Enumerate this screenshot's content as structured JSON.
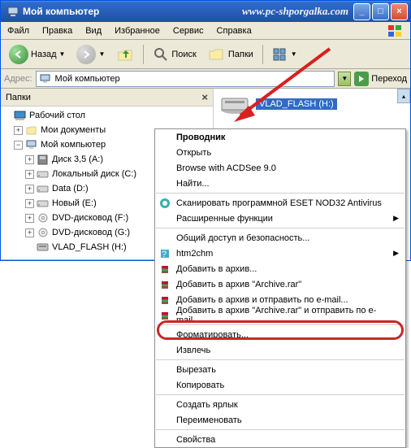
{
  "titlebar": {
    "title": "Мой компьютер",
    "watermark": "www.pc-shporgalka.com"
  },
  "menubar": {
    "file": "Файл",
    "edit": "Правка",
    "view": "Вид",
    "favorites": "Избранное",
    "service": "Сервис",
    "help": "Справка"
  },
  "toolbar": {
    "back": "Назад",
    "search": "Поиск",
    "folders": "Папки"
  },
  "addressbar": {
    "label": "Адрес:",
    "value": "Мой компьютер",
    "go": "Переход"
  },
  "sidebar": {
    "header": "Папки",
    "desktop": "Рабочий стол",
    "docs": "Мои документы",
    "computer": "Мой компьютер",
    "drives": {
      "floppy": "Диск 3,5 (A:)",
      "local": "Локальный диск (C:)",
      "data": "Data (D:)",
      "new": "Новый (E:)",
      "dvd1": "DVD-дисковод (F:)",
      "dvd2": "DVD-дисковод (G:)",
      "flash": "VLAD_FLASH (H:)"
    }
  },
  "content": {
    "drive_label": "VLAD_FLASH (H:)"
  },
  "contextmenu": {
    "header": "Проводник",
    "open": "Открыть",
    "acdsee": "Browse with ACDSee 9.0",
    "find": "Найти...",
    "eset": "Сканировать программной ESET NOD32 Antivirus",
    "extfunc": "Расширенные функции",
    "share": "Общий доступ и безопасность...",
    "htm2chm": "htm2chm",
    "rar1": "Добавить в архив...",
    "rar2": "Добавить в архив \"Archive.rar\"",
    "rar3": "Добавить в архив и отправить по e-mail...",
    "rar4": "Добавить в архив \"Archive.rar\" и отправить по e-mail",
    "format": "Форматировать...",
    "eject": "Извлечь",
    "cut": "Вырезать",
    "copy": "Копировать",
    "shortcut": "Создать ярлык",
    "rename": "Переименовать",
    "props": "Свойства"
  }
}
